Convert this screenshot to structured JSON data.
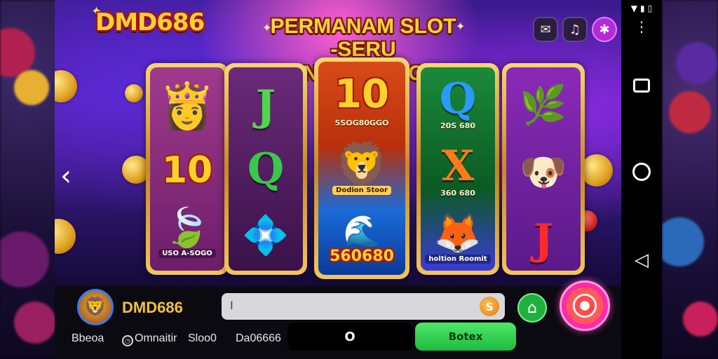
{
  "game": {
    "logo": "DMD686",
    "headline_line1": "PERMANAM SLOT",
    "headline_line2": "-SERU MENGUNTUNGAN",
    "top_buttons": [
      {
        "icon": "scroll-icon",
        "glyph": "✉"
      },
      {
        "icon": "music-icon",
        "glyph": "♫"
      },
      {
        "icon": "puzzle-icon",
        "glyph": "✱"
      }
    ],
    "prev_arrow_glyph": "‹",
    "reels": [
      {
        "symbols": [
          {
            "kind": "character",
            "glyph": "👸"
          },
          {
            "kind": "number",
            "text": "10"
          },
          {
            "kind": "fruit",
            "glyph": "🍃",
            "caption": "USO A-SOGO"
          }
        ]
      },
      {
        "symbols": [
          {
            "kind": "letter",
            "text": "J",
            "color": "#4cd84a"
          },
          {
            "kind": "letter",
            "text": "Q",
            "color": "#3ac84a"
          },
          {
            "kind": "gem",
            "glyph": "💠"
          }
        ]
      },
      {
        "symbols": [
          {
            "kind": "number",
            "text": "10",
            "caption": "5SOG80GGO"
          },
          {
            "kind": "character",
            "glyph": "🦁",
            "caption": "Dodion Stoor"
          },
          {
            "kind": "wave",
            "glyph": "🌊",
            "caption": "560680"
          }
        ]
      },
      {
        "symbols": [
          {
            "kind": "letter",
            "text": "Q",
            "color": "#2a9aff",
            "caption": "20S 680"
          },
          {
            "kind": "letter",
            "text": "X",
            "color": "#ff7a1a",
            "caption": "360 680"
          },
          {
            "kind": "character",
            "glyph": "🦊",
            "caption": "holtion Roomit"
          }
        ]
      },
      {
        "symbols": [
          {
            "kind": "fruit",
            "glyph": "🌿"
          },
          {
            "kind": "animal",
            "glyph": "🐶"
          },
          {
            "kind": "letter",
            "text": "J",
            "color": "#ff2a2a"
          }
        ]
      }
    ]
  },
  "bottom": {
    "avatar_glyph": "🦁",
    "brand": "DMD686",
    "search_value": "I",
    "search_button_glyph": "S",
    "home_glyph": "⌂",
    "tabs": [
      {
        "label": "Bbeoa"
      },
      {
        "label": "Omnaitir",
        "icon": "clock-icon"
      },
      {
        "label": "Sloo0"
      },
      {
        "label": "Da06666"
      }
    ],
    "dark_pill_label": "O",
    "green_pill_label": "Botex"
  },
  "system": {
    "status_icons": [
      "▼",
      "▮",
      "▯"
    ],
    "menu_glyph": "⋮"
  }
}
